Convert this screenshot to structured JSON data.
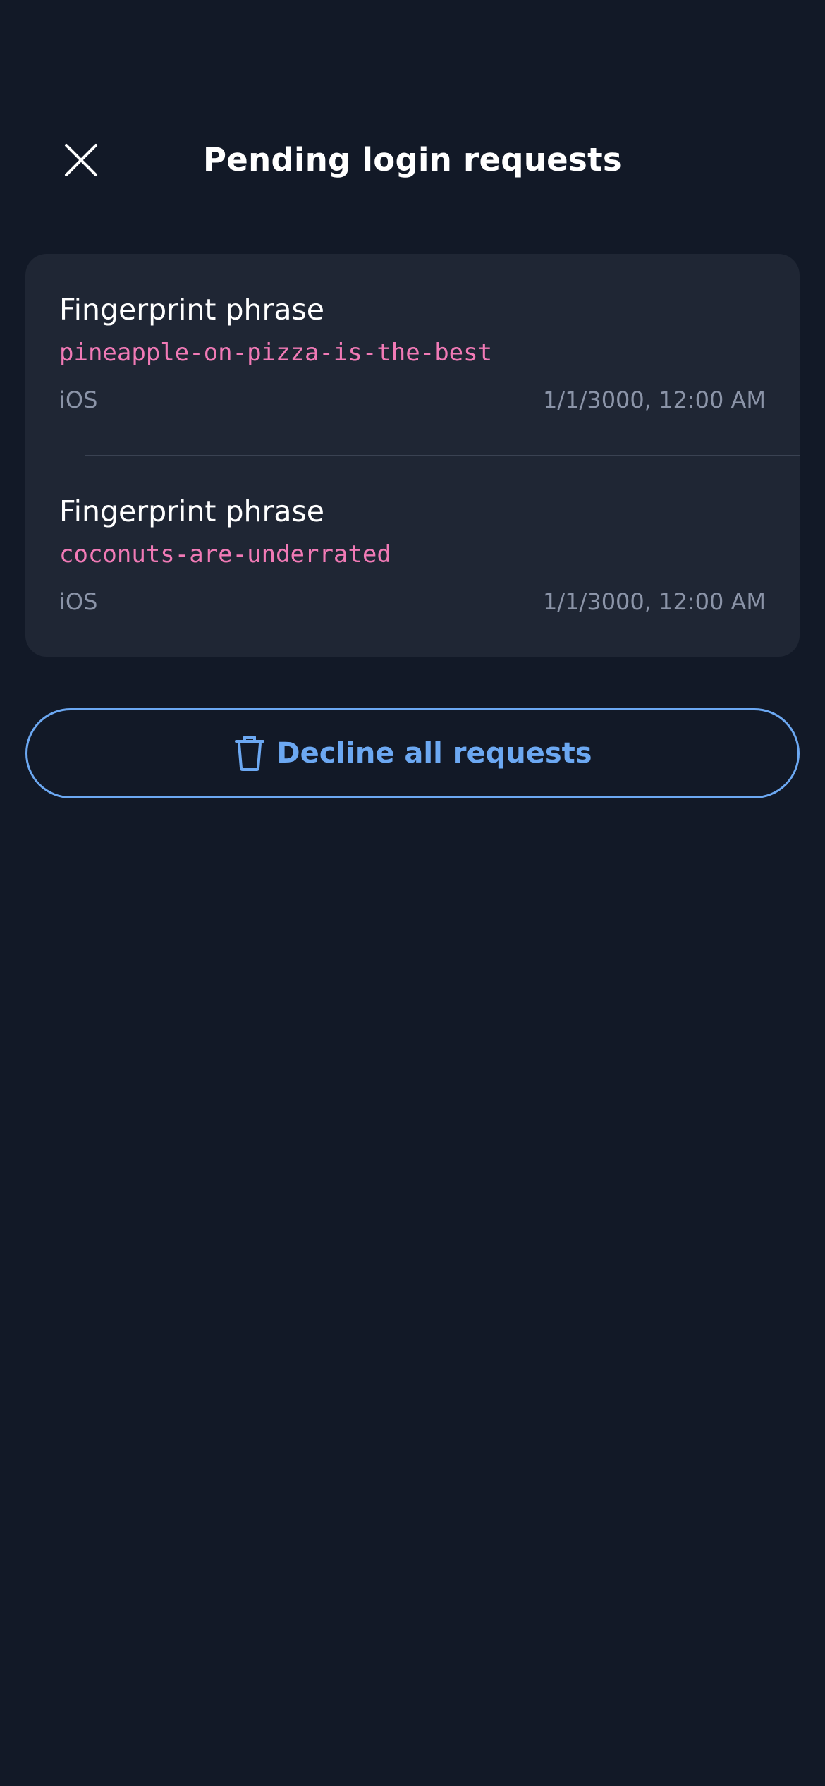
{
  "header": {
    "title": "Pending login requests",
    "close_icon": "close-icon"
  },
  "requests": [
    {
      "label": "Fingerprint phrase",
      "phrase": "pineapple-on-pizza-is-the-best",
      "platform": "iOS",
      "timestamp": "1/1/3000, 12:00 AM"
    },
    {
      "label": "Fingerprint phrase",
      "phrase": "coconuts-are-underrated",
      "platform": "iOS",
      "timestamp": "1/1/3000, 12:00 AM"
    }
  ],
  "actions": {
    "decline_all_label": "Decline all requests",
    "decline_icon": "trash-icon"
  },
  "colors": {
    "background": "#121927",
    "card": "#1f2634",
    "accent": "#6ca8f2",
    "phrase": "#f17ab6",
    "muted": "#8b94a8"
  }
}
